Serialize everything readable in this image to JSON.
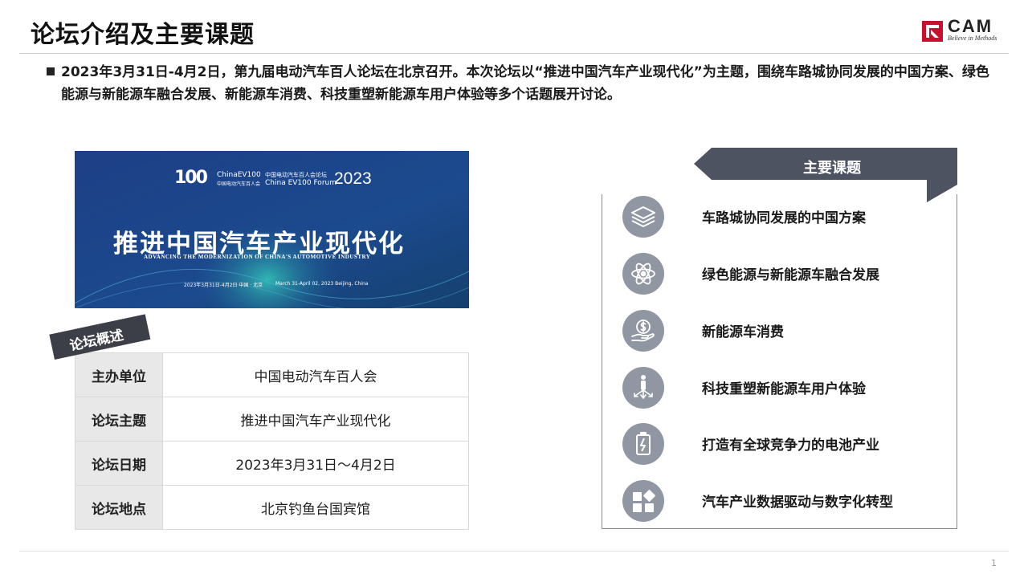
{
  "header": {
    "title": "论坛介绍及主要课题",
    "logo_text": "CAM",
    "logo_tagline": "Believe in Methods",
    "brand_color": "#c8102e"
  },
  "intro": {
    "text": "2023年3月31日-4月2日，第九届电动汽车百人论坛在北京召开。本次论坛以“推进中国汽车产业现代化”为主题，围绕车路城协同发展的中国方案、绿色能源与新能源车融合发展、新能源车消费、科技重塑新能源车用户体验等多个话题展开讨论。"
  },
  "banner": {
    "logo_num": "100",
    "logo_en": "ChinaEV100",
    "logo_cn": "中国电动汽车百人会",
    "forum_cn": "中国电动汽车百人会论坛",
    "forum_en": "China EV100 Forum",
    "year": "2023",
    "headline": "推进中国汽车产业现代化",
    "subline": "ADVANCING THE MODERNIZATION OF CHINA'S AUTOMOTIVE INDUSTRY",
    "date_cn": "2023年3月31日-4月2日    中国 · 北京",
    "date_en": "March 31-April 02, 2023    Beijing, China"
  },
  "overview": {
    "tag": "论坛概述",
    "rows": [
      {
        "key": "主办单位",
        "value": "中国电动汽车百人会"
      },
      {
        "key": "论坛主题",
        "value": "推进中国汽车产业现代化"
      },
      {
        "key": "论坛日期",
        "value": "2023年3月31日～4月2日"
      },
      {
        "key": "论坛地点",
        "value": "北京钓鱼台国宾馆"
      }
    ]
  },
  "topics": {
    "title": "主要课题",
    "items": [
      {
        "icon": "layers-icon",
        "label": "车路城协同发展的中国方案"
      },
      {
        "icon": "atom-icon",
        "label": "绿色能源与新能源车融合发展"
      },
      {
        "icon": "money-hand-icon",
        "label": "新能源车消费"
      },
      {
        "icon": "person-arrows-icon",
        "label": "科技重塑新能源车用户体验"
      },
      {
        "icon": "battery-icon",
        "label": "打造有全球竞争力的电池产业"
      },
      {
        "icon": "blocks-icon",
        "label": "汽车产业数据驱动与数字化转型"
      }
    ]
  },
  "footer": {
    "page_number": "1"
  }
}
